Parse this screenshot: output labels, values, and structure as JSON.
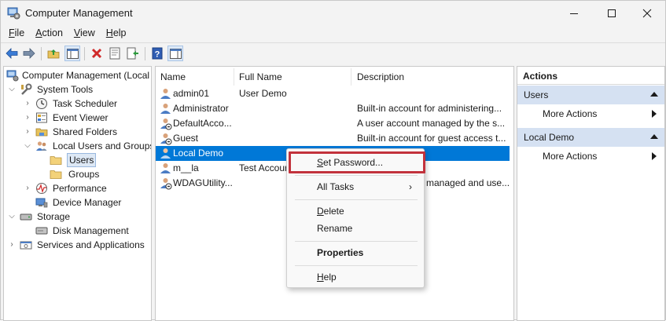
{
  "window": {
    "title": "Computer Management",
    "icon": "computer-management-icon",
    "controls": [
      "minimize-icon",
      "maximize-icon",
      "close-icon"
    ]
  },
  "menu": [
    {
      "label": "File",
      "accel": "F",
      "rest": "ile"
    },
    {
      "label": "Action",
      "accel": "A",
      "rest": "ction"
    },
    {
      "label": "View",
      "accel": "V",
      "rest": "iew"
    },
    {
      "label": "Help",
      "accel": "H",
      "rest": "elp"
    }
  ],
  "toolbar": {
    "buttons": [
      "back-icon",
      "forward-icon",
      "up-folder-icon",
      "show-hide-tree-icon",
      "delete-icon",
      "properties-icon",
      "export-list-icon",
      "help-icon",
      "show-hide-action-pane-icon"
    ]
  },
  "tree": {
    "items": [
      {
        "label": "Computer Management (Local",
        "icon": "computer-management-icon",
        "level": 0,
        "chevron": ""
      },
      {
        "label": "System Tools",
        "icon": "tools-icon",
        "level": 1,
        "chevron": "down"
      },
      {
        "label": "Task Scheduler",
        "icon": "clock-icon",
        "level": 2,
        "chevron": "right"
      },
      {
        "label": "Event Viewer",
        "icon": "event-viewer-icon",
        "level": 2,
        "chevron": "right"
      },
      {
        "label": "Shared Folders",
        "icon": "shared-folder-icon",
        "level": 2,
        "chevron": "right"
      },
      {
        "label": "Local Users and Groups",
        "icon": "users-groups-icon",
        "level": 2,
        "chevron": "down"
      },
      {
        "label": "Users",
        "icon": "folder-icon",
        "level": 3,
        "chevron": "",
        "selected": true
      },
      {
        "label": "Groups",
        "icon": "folder-icon",
        "level": 3,
        "chevron": ""
      },
      {
        "label": "Performance",
        "icon": "performance-icon",
        "level": 2,
        "chevron": "right"
      },
      {
        "label": "Device Manager",
        "icon": "device-manager-icon",
        "level": 2,
        "chevron": ""
      },
      {
        "label": "Storage",
        "icon": "storage-icon",
        "level": 1,
        "chevron": "down"
      },
      {
        "label": "Disk Management",
        "icon": "disk-icon",
        "level": 2,
        "chevron": ""
      },
      {
        "label": "Services and Applications",
        "icon": "services-icon",
        "level": 1,
        "chevron": "right"
      }
    ]
  },
  "list": {
    "columns": [
      "Name",
      "Full Name",
      "Description"
    ],
    "rows": [
      {
        "name": "admin01",
        "full_name": "User Demo",
        "description": ""
      },
      {
        "name": "Administrator",
        "full_name": "",
        "description": "Built-in account for administering..."
      },
      {
        "name": "DefaultAcco...",
        "full_name": "",
        "description": "A user account managed by the s..."
      },
      {
        "name": "Guest",
        "full_name": "",
        "description": "Built-in account for guest access t..."
      },
      {
        "name": "Local Demo",
        "full_name": "",
        "description": "",
        "selected": true
      },
      {
        "name": "m__la",
        "full_name": "Test Accour",
        "description": ""
      },
      {
        "name": "WDAGUtility...",
        "full_name": "",
        "description": "managed and use..."
      }
    ]
  },
  "actions": {
    "title": "Actions",
    "sections": [
      {
        "header": "Users",
        "items": [
          "More Actions"
        ]
      },
      {
        "header": "Local Demo",
        "items": [
          "More Actions"
        ]
      }
    ]
  },
  "context_menu": {
    "items": [
      {
        "label": "Set Password...",
        "accel": "S",
        "rest": "et Password...",
        "highlighted": true
      },
      {
        "separator": true
      },
      {
        "label": "All Tasks",
        "accel": "",
        "rest": "All Tasks",
        "submenu": true
      },
      {
        "separator": true
      },
      {
        "label": "Delete",
        "accel": "D",
        "rest": "elete"
      },
      {
        "label": "Rename",
        "accel": "",
        "rest": "Rename"
      },
      {
        "separator": true
      },
      {
        "label": "Properties",
        "accel": "",
        "rest": "Properties",
        "bold": true
      },
      {
        "separator": true
      },
      {
        "label": "Help",
        "accel": "H",
        "rest": "elp"
      }
    ],
    "highlight_color": "#c2323c"
  },
  "colors": {
    "selection": "#0078d7",
    "tree_selection": "#dde8f5",
    "actions_section": "#d5e1f2"
  }
}
